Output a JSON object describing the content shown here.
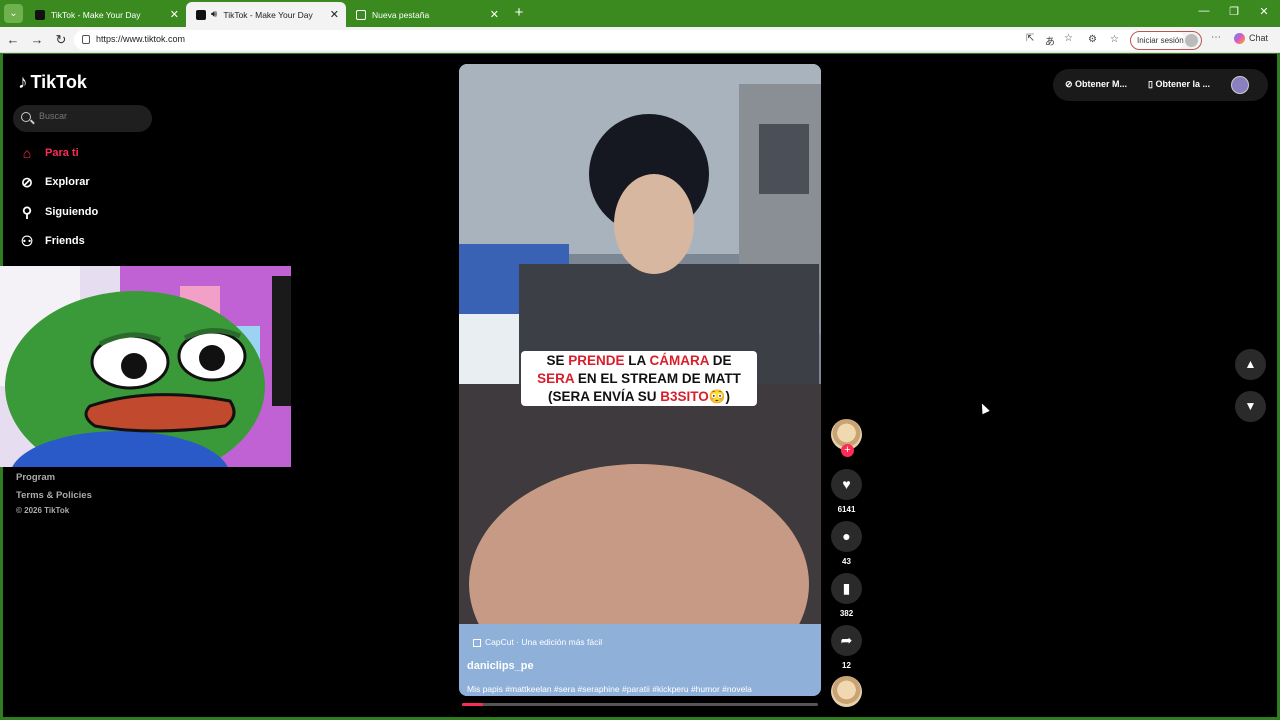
{
  "browser": {
    "tabs": [
      {
        "label": "TikTok - Make Your Day"
      },
      {
        "label": "TikTok - Make Your Day"
      },
      {
        "label": "Nueva pestaña"
      }
    ],
    "url": "https://www.tiktok.com",
    "signin_label": "Iniciar sesión",
    "chat_label": "Chat"
  },
  "sidebar": {
    "logo_text": "TikTok",
    "search_placeholder": "Buscar",
    "nav": [
      {
        "label": "Para ti",
        "icon": "home-icon"
      },
      {
        "label": "Explorar",
        "icon": "compass-icon"
      },
      {
        "label": "Siguiendo",
        "icon": "user-follow-icon"
      },
      {
        "label": "Friends",
        "icon": "friends-icon"
      }
    ],
    "footer_links": [
      "Program",
      "Terms & Policies"
    ],
    "copyright": "© 2026 TikTok"
  },
  "video": {
    "caption_lines": [
      [
        {
          "t": "SE ",
          "red": false
        },
        {
          "t": "PRENDE",
          "red": true
        },
        {
          "t": " LA ",
          "red": false
        },
        {
          "t": "CÁMARA",
          "red": true
        },
        {
          "t": " DE",
          "red": false
        }
      ],
      [
        {
          "t": "SERA",
          "red": true
        },
        {
          "t": " EN EL STREAM DE MATT",
          "red": false
        }
      ],
      [
        {
          "t": "(SERA ENVÍA SU ",
          "red": false
        },
        {
          "t": "B3SITO",
          "red": true
        },
        {
          "t": "😳)",
          "red": false
        }
      ]
    ],
    "capcut_label": "CapCut · Una edición más fácil",
    "author": "daniclips_pe",
    "description": "Mis papis #mattkeelan #sera #seraphine #paratii #kickperu #humor #novela",
    "progress": 0.06
  },
  "actions": {
    "likes": "6141",
    "comments": "43",
    "bookmarks": "382",
    "shares": "12"
  },
  "topbar": {
    "coins_label": "Obtener M...",
    "app_label": "Obtener la ..."
  },
  "colors": {
    "accent": "#fe2c55",
    "tab_bar": "#3a8a1f"
  }
}
